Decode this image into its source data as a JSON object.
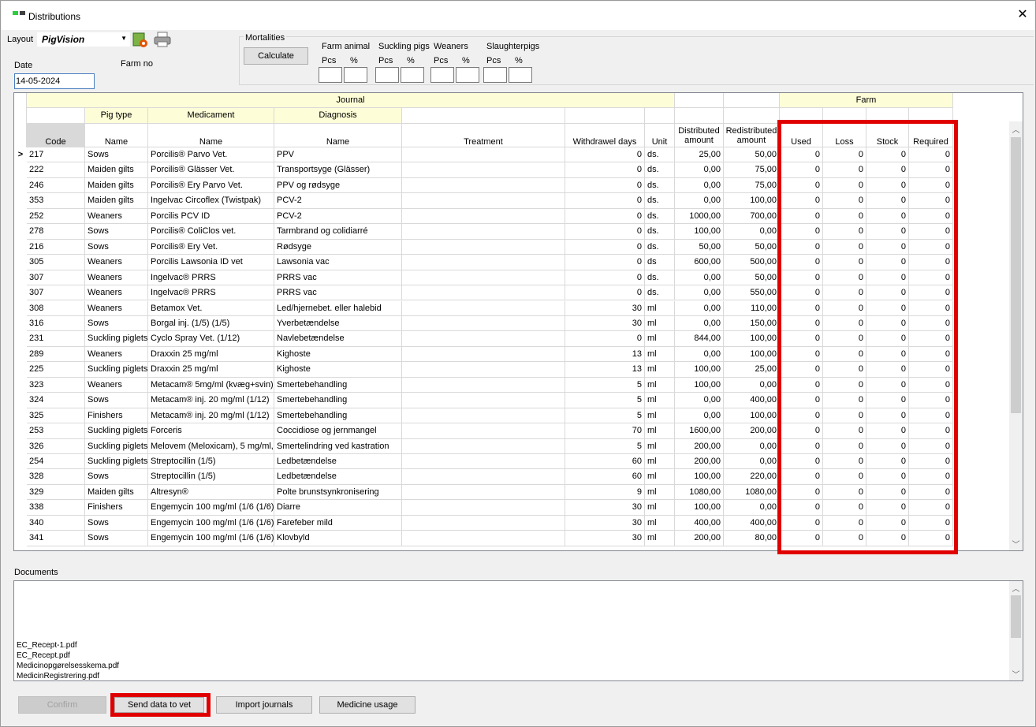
{
  "window": {
    "title": "Distributions",
    "close_glyph": "✕"
  },
  "toolbar": {
    "layout_label": "Layout",
    "layout_value": "PigVision",
    "date_label": "Date",
    "date_value": "14-05-2024",
    "farm_no_label": "Farm no"
  },
  "mortalities": {
    "title": "Mortalities",
    "calculate_label": "Calculate",
    "groups": [
      {
        "label": "Farm animal",
        "pcs": "Pcs",
        "pct": "%"
      },
      {
        "label": "Suckling pigs",
        "pcs": "Pcs",
        "pct": "%"
      },
      {
        "label": "Weaners",
        "pcs": "Pcs",
        "pct": "%"
      },
      {
        "label": "Slaughterpigs",
        "pcs": "Pcs",
        "pct": "%"
      }
    ]
  },
  "grid": {
    "group_journal": "Journal",
    "group_farm": "Farm",
    "sub_pigtype": "Pig type",
    "sub_medicament": "Medicament",
    "sub_diagnosis": "Diagnosis",
    "cols": {
      "code": "Code",
      "pigtype_name": "Name",
      "medicament_name": "Name",
      "diagnosis_name": "Name",
      "treatment": "Treatment",
      "withdrawal": "Withdrawel days",
      "unit": "Unit",
      "distributed": "Distributed amount",
      "redistributed": "Redistributed amount",
      "used": "Used",
      "loss": "Loss",
      "stock": "Stock",
      "required": "Required"
    },
    "current_row_marker": ">",
    "rows": [
      [
        "217",
        "Sows",
        "Porcilis® Parvo Vet.",
        "PPV",
        "0",
        "ds.",
        "25,00",
        "50,00",
        "0",
        "0",
        "0",
        "0"
      ],
      [
        "222",
        "Maiden gilts",
        "Porcilis® Glässer Vet.",
        "Transportsyge (Glässer)",
        "0",
        "ds.",
        "0,00",
        "75,00",
        "0",
        "0",
        "0",
        "0"
      ],
      [
        "246",
        "Maiden gilts",
        "Porcilis® Ery Parvo Vet.",
        "PPV og rødsyge",
        "0",
        "ds.",
        "0,00",
        "75,00",
        "0",
        "0",
        "0",
        "0"
      ],
      [
        "353",
        "Maiden gilts",
        "Ingelvac Circoflex (Twistpak)",
        "PCV-2",
        "0",
        "ds.",
        "0,00",
        "100,00",
        "0",
        "0",
        "0",
        "0"
      ],
      [
        "252",
        "Weaners",
        "Porcilis PCV ID",
        "PCV-2",
        "0",
        "ds.",
        "1000,00",
        "700,00",
        "0",
        "0",
        "0",
        "0"
      ],
      [
        "278",
        "Sows",
        "Porcilis® ColiClos vet.",
        "Tarmbrand og colidiarré",
        "0",
        "ds.",
        "100,00",
        "0,00",
        "0",
        "0",
        "0",
        "0"
      ],
      [
        "216",
        "Sows",
        "Porcilis® Ery Vet.",
        "Rødsyge",
        "0",
        "ds.",
        "50,00",
        "50,00",
        "0",
        "0",
        "0",
        "0"
      ],
      [
        "305",
        "Weaners",
        "Porcilis Lawsonia ID vet",
        "Lawsonia vac",
        "0",
        "ds",
        "600,00",
        "500,00",
        "0",
        "0",
        "0",
        "0"
      ],
      [
        "307",
        "Weaners",
        "Ingelvac® PRRS",
        "PRRS vac",
        "0",
        "ds.",
        "0,00",
        "50,00",
        "0",
        "0",
        "0",
        "0"
      ],
      [
        "307",
        "Weaners",
        "Ingelvac® PRRS",
        "PRRS vac",
        "0",
        "ds.",
        "0,00",
        "550,00",
        "0",
        "0",
        "0",
        "0"
      ],
      [
        "308",
        "Weaners",
        "Betamox Vet.",
        "Led/hjernebet. eller halebid",
        "30",
        "ml",
        "0,00",
        "110,00",
        "0",
        "0",
        "0",
        "0"
      ],
      [
        "316",
        "Sows",
        "Borgal inj. (1/5) (1/5)",
        "Yverbetændelse",
        "30",
        "ml",
        "0,00",
        "150,00",
        "0",
        "0",
        "0",
        "0"
      ],
      [
        "231",
        "Suckling piglets",
        "Cyclo Spray Vet. (1/12)",
        "Navlebetændelse",
        "0",
        "ml",
        "844,00",
        "100,00",
        "0",
        "0",
        "0",
        "0"
      ],
      [
        "289",
        "Weaners",
        "Draxxin 25 mg/ml",
        "Kighoste",
        "13",
        "ml",
        "0,00",
        "100,00",
        "0",
        "0",
        "0",
        "0"
      ],
      [
        "225",
        "Suckling piglets",
        "Draxxin 25 mg/ml",
        "Kighoste",
        "13",
        "ml",
        "100,00",
        "25,00",
        "0",
        "0",
        "0",
        "0"
      ],
      [
        "323",
        "Weaners",
        "Metacam® 5mg/ml (kvæg+svin)",
        "Smertebehandling",
        "5",
        "ml",
        "100,00",
        "0,00",
        "0",
        "0",
        "0",
        "0"
      ],
      [
        "324",
        "Sows",
        "Metacam® inj. 20 mg/ml (1/12)",
        "Smertebehandling",
        "5",
        "ml",
        "0,00",
        "400,00",
        "0",
        "0",
        "0",
        "0"
      ],
      [
        "325",
        "Finishers",
        "Metacam® inj. 20 mg/ml (1/12)",
        "Smertebehandling",
        "5",
        "ml",
        "0,00",
        "100,00",
        "0",
        "0",
        "0",
        "0"
      ],
      [
        "253",
        "Suckling piglets",
        "Forceris",
        "Coccidiose og jernmangel",
        "70",
        "ml",
        "1600,00",
        "200,00",
        "0",
        "0",
        "0",
        "0"
      ],
      [
        "326",
        "Suckling piglets",
        "Melovem (Meloxicam), 5 mg/ml,",
        "Smertelindring ved kastration",
        "5",
        "ml",
        "200,00",
        "0,00",
        "0",
        "0",
        "0",
        "0"
      ],
      [
        "254",
        "Suckling piglets",
        "Streptocillin (1/5)",
        "Ledbetændelse",
        "60",
        "ml",
        "200,00",
        "0,00",
        "0",
        "0",
        "0",
        "0"
      ],
      [
        "328",
        "Sows",
        "Streptocillin (1/5)",
        "Ledbetændelse",
        "60",
        "ml",
        "100,00",
        "220,00",
        "0",
        "0",
        "0",
        "0"
      ],
      [
        "329",
        "Maiden gilts",
        "Altresyn®",
        "Polte brunstsynkronisering",
        "9",
        "ml",
        "1080,00",
        "1080,00",
        "0",
        "0",
        "0",
        "0"
      ],
      [
        "338",
        "Finishers",
        "Engemycin 100 mg/ml (1/6 (1/6)",
        "Diarre",
        "30",
        "ml",
        "100,00",
        "0,00",
        "0",
        "0",
        "0",
        "0"
      ],
      [
        "340",
        "Sows",
        "Engemycin 100 mg/ml (1/6 (1/6)",
        "Farefeber mild",
        "30",
        "ml",
        "400,00",
        "400,00",
        "0",
        "0",
        "0",
        "0"
      ],
      [
        "341",
        "Sows",
        "Engemycin 100 mg/ml (1/6 (1/6)",
        "Klovbyld",
        "30",
        "ml",
        "200,00",
        "80,00",
        "0",
        "0",
        "0",
        "0"
      ]
    ]
  },
  "documents": {
    "label": "Documents",
    "files": [
      "EC_Recept-1.pdf",
      "EC_Recept.pdf",
      "Medicinopgørelsesskema.pdf",
      "MedicinRegistrering.pdf"
    ]
  },
  "buttons": {
    "confirm": "Confirm",
    "send": "Send data to vet",
    "import": "Import journals",
    "usage": "Medicine usage"
  },
  "colors": {
    "highlight": "#e00000",
    "header_yellow": "#fdfdd8",
    "app_icon_green": "#2ecc40"
  }
}
